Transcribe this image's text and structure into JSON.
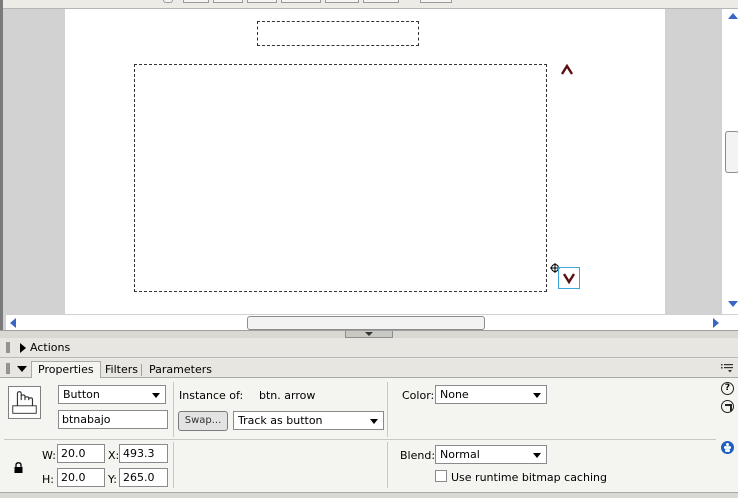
{
  "colors": {
    "stage_bg": "#ffffff",
    "pasteboard": "#d2d2d2",
    "panel_bg": "#f4f4f0",
    "accent_blue": "#3a66c4",
    "arrow_symbol": "#5a0e0e",
    "selection_outline": "#3aa7d8"
  },
  "icons": {
    "arrow_up": "caret-up-symbol",
    "arrow_down": "caret-down-symbol",
    "registration": "crosshair-circle",
    "symbol": "hand-button-icon",
    "help": "question-icon",
    "edit": "arrow-edit-icon",
    "accessibility": "accessibility-icon",
    "lock": "lock-icon"
  },
  "actions_panel": {
    "label": "Actions"
  },
  "properties_panel": {
    "tabs": [
      {
        "label": "Properties",
        "active": true
      },
      {
        "label": "Filters",
        "active": false
      },
      {
        "label": "Parameters",
        "active": false
      }
    ],
    "symbol_type": "Button",
    "instance_name": "btnabajo",
    "instance_of_label": "Instance of:",
    "instance_of_value": "btn. arrow",
    "swap_label": "Swap...",
    "track_option": "Track as button",
    "color_label": "Color:",
    "color_value": "None",
    "w_label": "W:",
    "w_value": "20.0",
    "h_label": "H:",
    "h_value": "20.0",
    "x_label": "X:",
    "x_value": "493.3",
    "y_label": "Y:",
    "y_value": "265.0",
    "blend_label": "Blend:",
    "blend_value": "Normal",
    "cache_label": "Use runtime bitmap caching",
    "help_glyph": "?"
  }
}
